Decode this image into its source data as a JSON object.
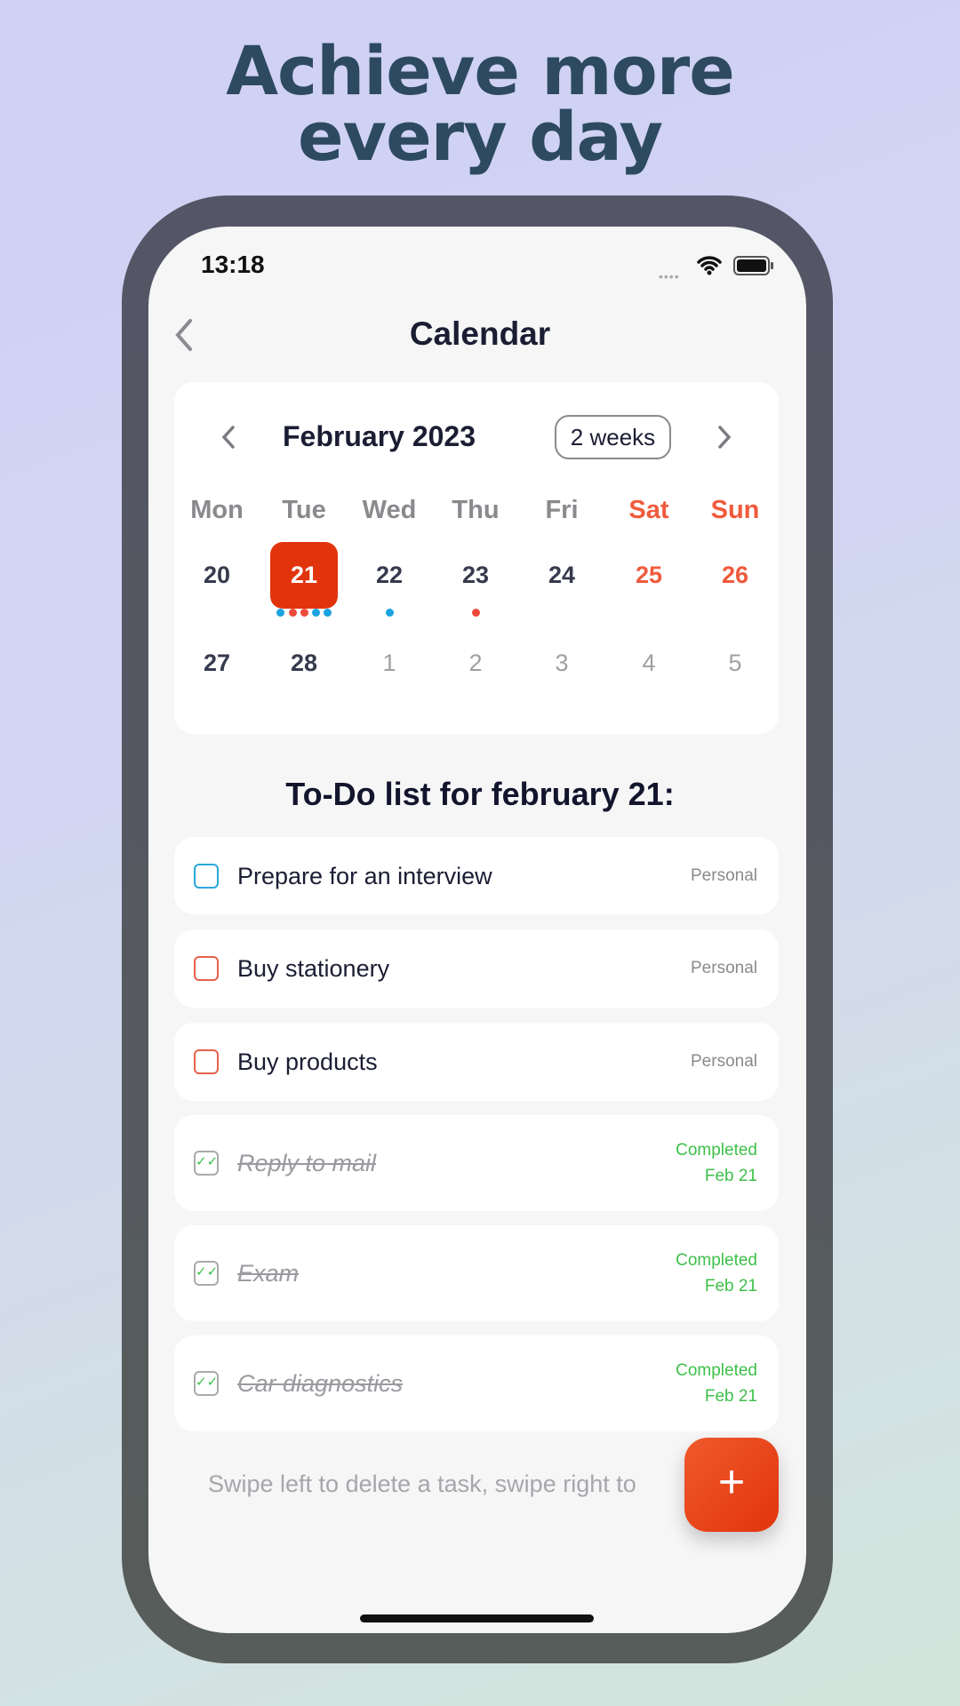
{
  "headline": {
    "line1": "Achieve more",
    "line2": "every day"
  },
  "status_bar": {
    "time": "13:18"
  },
  "nav": {
    "title": "Calendar"
  },
  "calendar": {
    "month_label": "February 2023",
    "range_button": "2 weeks",
    "weekdays": [
      "Mon",
      "Tue",
      "Wed",
      "Thu",
      "Fri",
      "Sat",
      "Sun"
    ],
    "weeks": [
      [
        "20",
        "21",
        "22",
        "23",
        "24",
        "25",
        "26"
      ],
      [
        "27",
        "28",
        "1",
        "2",
        "3",
        "4",
        "5"
      ]
    ],
    "selected_day": "21",
    "colors": {
      "selected": "#e2340c",
      "weekend": "#f05a3c",
      "dot_blue": "#1aa3e0",
      "dot_red": "#ee4a3c"
    }
  },
  "todo": {
    "heading": "To-Do list for february 21:",
    "items": [
      {
        "title": "Prepare for an interview",
        "tag": "Personal",
        "checkbox_color": "#2aa8dc"
      },
      {
        "title": "Buy stationery",
        "tag": "Personal",
        "checkbox_color": "#e8604c"
      },
      {
        "title": "Buy products",
        "tag": "Personal",
        "checkbox_color": "#e8604c"
      },
      {
        "title": "Reply to mail",
        "status": "Completed",
        "date": "Feb 21"
      },
      {
        "title": "Exam",
        "status": "Completed",
        "date": "Feb 21"
      },
      {
        "title": "Car diagnostics",
        "status": "Completed",
        "date": "Feb 21"
      }
    ],
    "hint": "Swipe left to delete a task, swipe right to"
  },
  "fab": {
    "label": "+"
  }
}
